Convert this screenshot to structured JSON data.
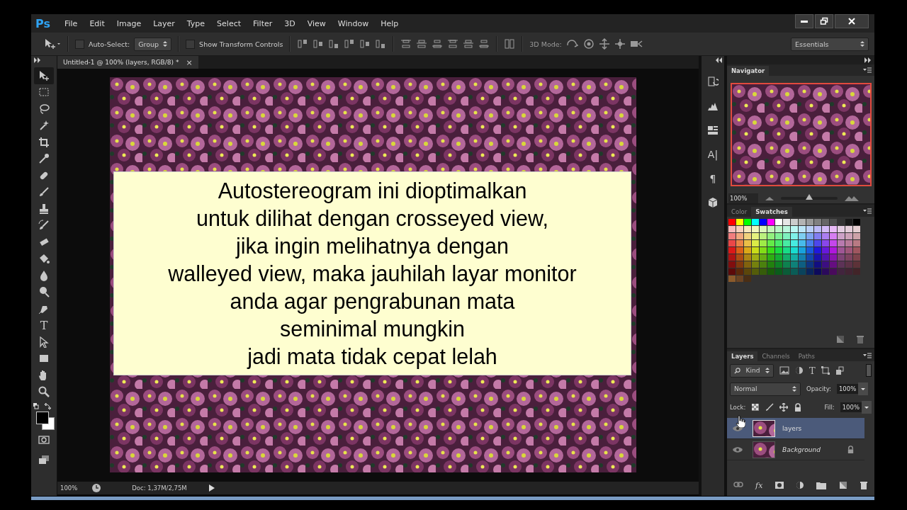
{
  "app": {
    "logo": "Ps"
  },
  "menu": [
    "File",
    "Edit",
    "Image",
    "Layer",
    "Type",
    "Select",
    "Filter",
    "3D",
    "View",
    "Window",
    "Help"
  ],
  "options_bar": {
    "auto_select": {
      "label": "Auto-Select:",
      "checked": false,
      "value": "Group"
    },
    "transform_controls": {
      "label": "Show Transform Controls",
      "checked": false
    },
    "mode_label": "3D Mode:",
    "workspace": "Essentials"
  },
  "tools": [
    {
      "kind": "move",
      "selected": true
    },
    {
      "kind": "marquee",
      "selected": false
    },
    {
      "kind": "lasso",
      "selected": false
    },
    {
      "kind": "wand",
      "selected": false
    },
    {
      "kind": "crop",
      "selected": false
    },
    {
      "kind": "eyedropper",
      "selected": false
    },
    {
      "kind": "healing",
      "selected": false
    },
    {
      "kind": "brush",
      "selected": false
    },
    {
      "kind": "stamp",
      "selected": false
    },
    {
      "kind": "history",
      "selected": false
    },
    {
      "kind": "eraser",
      "selected": false
    },
    {
      "kind": "bucket",
      "selected": false
    },
    {
      "kind": "blur",
      "selected": false
    },
    {
      "kind": "dodge",
      "selected": false
    },
    {
      "kind": "pen",
      "selected": false
    },
    {
      "kind": "type",
      "glyph": "T",
      "selected": false
    },
    {
      "kind": "path",
      "selected": false
    },
    {
      "kind": "shape",
      "selected": false
    },
    {
      "kind": "hand",
      "selected": false
    },
    {
      "kind": "zoom",
      "selected": false
    }
  ],
  "document": {
    "tab": "Untitled-1 @ 100% (layers, RGB/8) *",
    "close": "×",
    "text_lines": [
      "Autostereogram ini dioptimalkan",
      "untuk dilihat dengan crosseyed view,",
      "jika ingin melihatnya dengan",
      "walleyed view, maka jauhilah layar monitor",
      "anda agar pengrabunan mata",
      "seminimal mungkin",
      "jadi mata tidak cepat lelah"
    ]
  },
  "status_bar": {
    "zoom": "100%",
    "info": "Doc: 1,37M/2,75M"
  },
  "side_icons": [
    {
      "kind": "history"
    },
    {
      "kind": "histogram"
    },
    {
      "kind": "info"
    },
    {
      "kind": "character",
      "glyph": "A|"
    },
    {
      "kind": "paragraph",
      "glyph": "¶"
    },
    {
      "kind": "cube"
    }
  ],
  "navigator": {
    "tab": "Navigator",
    "zoom": "100%",
    "level": 0.5
  },
  "swatches": {
    "tabs": [
      {
        "label": "Color",
        "selected": false
      },
      {
        "label": "Swatches",
        "selected": true
      }
    ]
  },
  "layers_panel": {
    "tabs": [
      {
        "label": "Layers",
        "selected": true
      },
      {
        "label": "Channels",
        "selected": false
      },
      {
        "label": "Paths",
        "selected": false
      }
    ],
    "filter": "Kind",
    "type_glyph": "T",
    "blend_mode": "Normal",
    "opacity_label": "Opacity:",
    "opacity": "100%",
    "lock_label": "Lock:",
    "fill_label": "Fill:",
    "fill": "100%",
    "fx_glyph": "fx",
    "layers": [
      {
        "name": "layers",
        "kind": "normal",
        "selected": true,
        "visible": true,
        "locked": false
      },
      {
        "name": "Background",
        "kind": "background",
        "selected": false,
        "visible": true,
        "locked": true
      }
    ]
  }
}
